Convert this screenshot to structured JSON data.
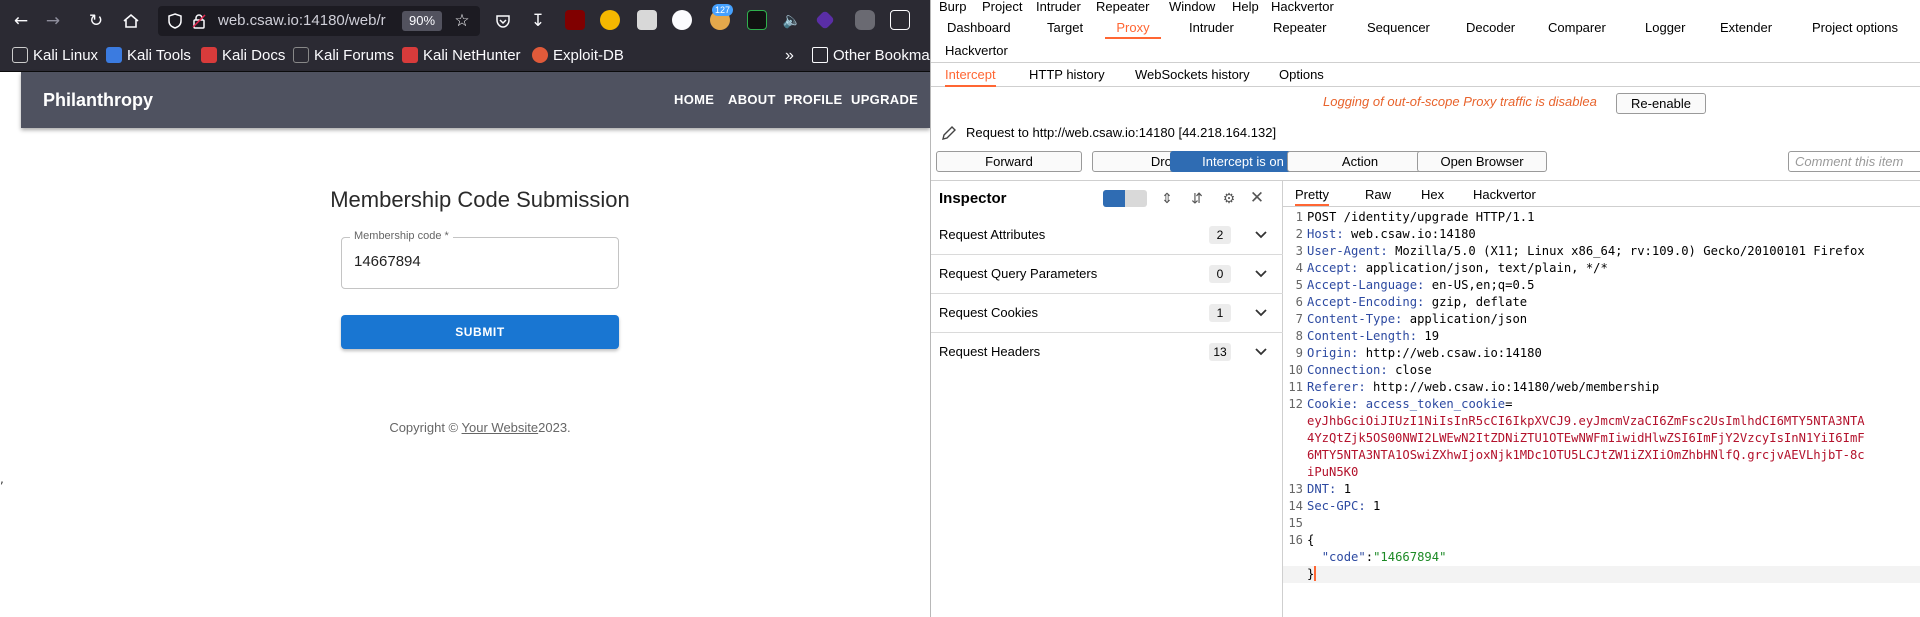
{
  "firefox": {
    "url": "web.csaw.io:14180/web/r",
    "zoom": "90%",
    "ext_badge": "127",
    "bookmarks": [
      "Kali Linux",
      "Kali Tools",
      "Kali Docs",
      "Kali Forums",
      "Kali NetHunter",
      "Exploit-DB"
    ],
    "other_bookmarks": "Other Bookmar",
    "icons": [
      "back-icon",
      "forward-icon",
      "reload-icon",
      "home-icon",
      "shield-icon",
      "lock-icon",
      "star-icon",
      "pocket-icon",
      "download-icon",
      "extension-icon"
    ]
  },
  "page": {
    "brand": "Philanthropy",
    "nav": [
      "HOME",
      "ABOUT",
      "PROFILE",
      "UPGRADE"
    ],
    "form_title": "Membership Code Submission",
    "code_label": "Membership code *",
    "code_value": "14667894",
    "submit_label": "SUBMIT",
    "copyright_prefix": "Copyright ©",
    "copyright_link": "Your Website",
    "copyright_year": "2023.",
    "stray_mark": ","
  },
  "burp": {
    "menu": [
      "Burp",
      "Project",
      "Intruder",
      "Repeater",
      "Window",
      "Help",
      "Hackvertor"
    ],
    "main_tabs": [
      "Dashboard",
      "Target",
      "Proxy",
      "Intruder",
      "Repeater",
      "Sequencer",
      "Decoder",
      "Comparer",
      "Logger",
      "Extender",
      "Project options",
      "Hackvertor"
    ],
    "active_main_tab": "Proxy",
    "sub_tabs": [
      "Intercept",
      "HTTP history",
      "WebSockets history",
      "Options"
    ],
    "active_sub_tab": "Intercept",
    "warning": "Logging of out-of-scope Proxy traffic is disablea",
    "reenable_label": "Re-enable",
    "request_to": "Request to http://web.csaw.io:14180  [44.218.164.132]",
    "actions": {
      "forward": "Forward",
      "drop": "Drop",
      "intercept": "Intercept is on",
      "action": "Action",
      "open_browser": "Open Browser"
    },
    "comment_placeholder": "Comment this item",
    "inspector": {
      "title": "Inspector",
      "rows": [
        {
          "label": "Request Attributes",
          "count": "2"
        },
        {
          "label": "Request Query Parameters",
          "count": "0"
        },
        {
          "label": "Request Cookies",
          "count": "1"
        },
        {
          "label": "Request Headers",
          "count": "13"
        }
      ]
    },
    "editor_tabs": [
      "Pretty",
      "Raw",
      "Hex",
      "Hackvertor"
    ],
    "active_editor_tab": "Pretty",
    "request": {
      "line1": "POST /identity/upgrade HTTP/1.1",
      "host_key": "Host:",
      "host_val": "web.csaw.io:14180",
      "ua_key": "User-Agent:",
      "ua_val": "Mozilla/5.0 (X11; Linux x86_64; rv:109.0) Gecko/20100101 Firefox",
      "accept_key": "Accept:",
      "accept_val": "application/json, text/plain, */*",
      "lang_key": "Accept-Language:",
      "lang_val": "en-US,en;q=0.5",
      "enc_key": "Accept-Encoding:",
      "enc_val": "gzip, deflate",
      "ctype_key": "Content-Type:",
      "ctype_val": "application/json",
      "clen_key": "Content-Length:",
      "clen_val": "19",
      "origin_key": "Origin:",
      "origin_val": "http://web.csaw.io:14180",
      "conn_key": "Connection:",
      "conn_val": "close",
      "ref_key": "Referer:",
      "ref_val": "http://web.csaw.io:14180/web/membership",
      "cookie_key": "Cookie:",
      "cookie_name": "access_token_cookie",
      "cookie_val_1": "eyJhbGciOiJIUzI1NiIsInR5cCI6IkpXVCJ9.eyJmcmVzaCI6ZmFsc2UsImlhdCI6MTY5NTA3NTA",
      "cookie_val_2": "4YzQtZjk5OS00NWI2LWEwN2ItZDNiZTU1OTEwNWFmIiwidHlwZSI6ImFjY2VzcyIsInN1YiI6ImF",
      "cookie_val_3": "6MTY5NTA3NTA1OSwiZXhwIjoxNjk1MDc1OTU5LCJtZW1iZXIiOmZhbHNlfQ.grcjvAEVLhjbT-8c",
      "cookie_val_4": "iPuN5K0",
      "dnt_key": "DNT:",
      "dnt_val": "1",
      "gpc_key": "Sec-GPC:",
      "gpc_val": "1",
      "body_open": "{",
      "body_key": "\"code\"",
      "body_colon": ":",
      "body_val": "\"14667894\"",
      "body_close": "}",
      "line_numbers": [
        "1",
        "2",
        "3",
        "4",
        "5",
        "6",
        "7",
        "8",
        "9",
        "10",
        "11",
        "12",
        "13",
        "14",
        "15",
        "16"
      ]
    }
  }
}
